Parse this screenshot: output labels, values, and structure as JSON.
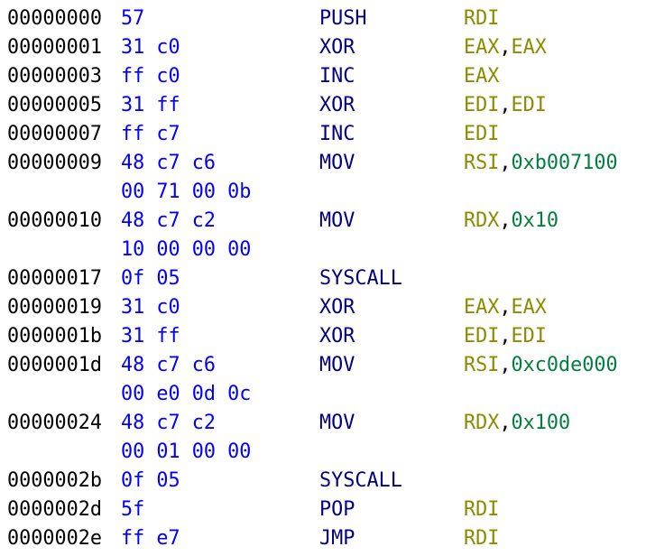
{
  "colors": {
    "address": "#000000",
    "bytes": "#0000ff",
    "mnemonic": "#000080",
    "register": "#8b8b00",
    "immediate": "#007f3f",
    "punct": "#000000"
  },
  "lines": [
    {
      "addr": "00000000",
      "bytes": "57",
      "mnem": "PUSH",
      "ops": [
        {
          "t": "RDI",
          "k": "register"
        }
      ]
    },
    {
      "addr": "00000001",
      "bytes": "31 c0",
      "mnem": "XOR",
      "ops": [
        {
          "t": "EAX",
          "k": "register"
        },
        {
          "t": ",",
          "k": "punct"
        },
        {
          "t": "EAX",
          "k": "register"
        }
      ]
    },
    {
      "addr": "00000003",
      "bytes": "ff c0",
      "mnem": "INC",
      "ops": [
        {
          "t": "EAX",
          "k": "register"
        }
      ]
    },
    {
      "addr": "00000005",
      "bytes": "31 ff",
      "mnem": "XOR",
      "ops": [
        {
          "t": "EDI",
          "k": "register"
        },
        {
          "t": ",",
          "k": "punct"
        },
        {
          "t": "EDI",
          "k": "register"
        }
      ]
    },
    {
      "addr": "00000007",
      "bytes": "ff c7",
      "mnem": "INC",
      "ops": [
        {
          "t": "EDI",
          "k": "register"
        }
      ]
    },
    {
      "addr": "00000009",
      "bytes": "48 c7 c6",
      "mnem": "MOV",
      "ops": [
        {
          "t": "RSI",
          "k": "register"
        },
        {
          "t": ",",
          "k": "punct"
        },
        {
          "t": "0xb007100",
          "k": "immediate"
        }
      ]
    },
    {
      "addr": "",
      "bytes": "00 71 00 0b",
      "mnem": "",
      "ops": []
    },
    {
      "addr": "00000010",
      "bytes": "48 c7 c2",
      "mnem": "MOV",
      "ops": [
        {
          "t": "RDX",
          "k": "register"
        },
        {
          "t": ",",
          "k": "punct"
        },
        {
          "t": "0x10",
          "k": "immediate"
        }
      ]
    },
    {
      "addr": "",
      "bytes": "10 00 00 00",
      "mnem": "",
      "ops": []
    },
    {
      "addr": "00000017",
      "bytes": "0f 05",
      "mnem": "SYSCALL",
      "ops": []
    },
    {
      "addr": "00000019",
      "bytes": "31 c0",
      "mnem": "XOR",
      "ops": [
        {
          "t": "EAX",
          "k": "register"
        },
        {
          "t": ",",
          "k": "punct"
        },
        {
          "t": "EAX",
          "k": "register"
        }
      ]
    },
    {
      "addr": "0000001b",
      "bytes": "31 ff",
      "mnem": "XOR",
      "ops": [
        {
          "t": "EDI",
          "k": "register"
        },
        {
          "t": ",",
          "k": "punct"
        },
        {
          "t": "EDI",
          "k": "register"
        }
      ]
    },
    {
      "addr": "0000001d",
      "bytes": "48 c7 c6",
      "mnem": "MOV",
      "ops": [
        {
          "t": "RSI",
          "k": "register"
        },
        {
          "t": ",",
          "k": "punct"
        },
        {
          "t": "0xc0de000",
          "k": "immediate"
        }
      ]
    },
    {
      "addr": "",
      "bytes": "00 e0 0d 0c",
      "mnem": "",
      "ops": []
    },
    {
      "addr": "00000024",
      "bytes": "48 c7 c2",
      "mnem": "MOV",
      "ops": [
        {
          "t": "RDX",
          "k": "register"
        },
        {
          "t": ",",
          "k": "punct"
        },
        {
          "t": "0x100",
          "k": "immediate"
        }
      ]
    },
    {
      "addr": "",
      "bytes": "00 01 00 00",
      "mnem": "",
      "ops": []
    },
    {
      "addr": "0000002b",
      "bytes": "0f 05",
      "mnem": "SYSCALL",
      "ops": []
    },
    {
      "addr": "0000002d",
      "bytes": "5f",
      "mnem": "POP",
      "ops": [
        {
          "t": "RDI",
          "k": "register"
        }
      ]
    },
    {
      "addr": "0000002e",
      "bytes": "ff e7",
      "mnem": "JMP",
      "ops": [
        {
          "t": "RDI",
          "k": "register"
        }
      ]
    }
  ]
}
